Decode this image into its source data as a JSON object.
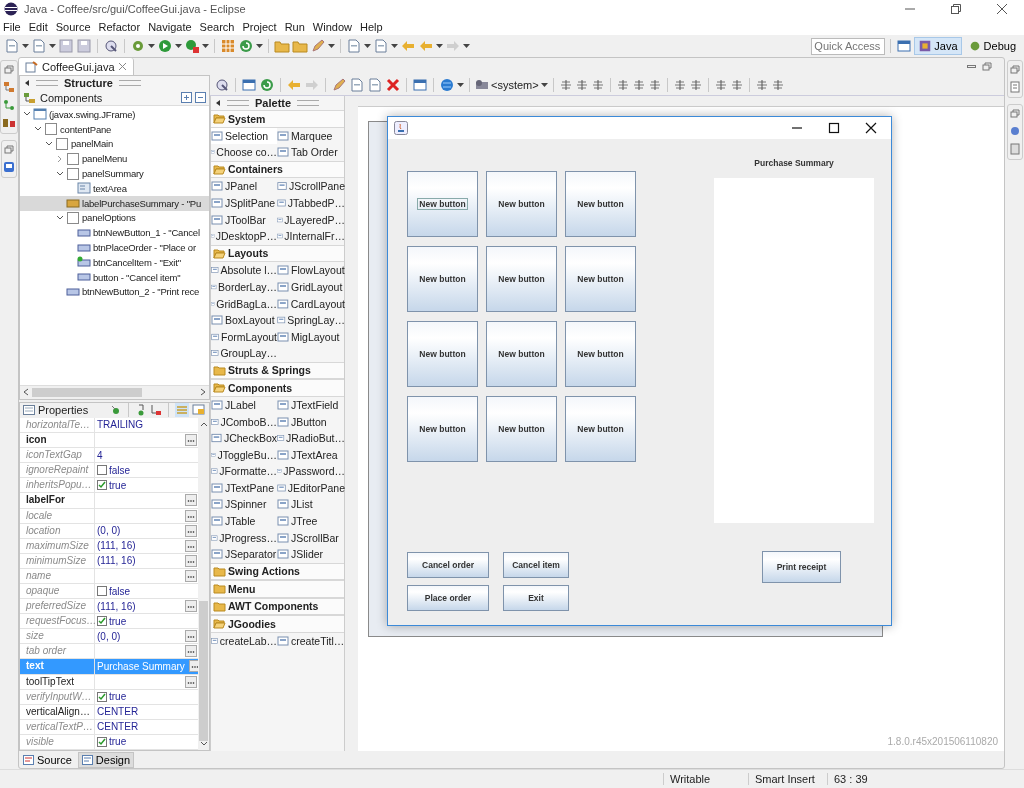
{
  "window": {
    "title": "Java - Coffee/src/gui/CoffeeGui.java - Eclipse"
  },
  "menu": [
    "File",
    "Edit",
    "Source",
    "Refactor",
    "Navigate",
    "Search",
    "Project",
    "Run",
    "Window",
    "Help"
  ],
  "toolbar": {
    "quick_access": {
      "placeholder": "Quick Access"
    },
    "perspectives": [
      {
        "label": "Java",
        "selected": true
      },
      {
        "label": "Debug",
        "selected": false
      }
    ]
  },
  "editor_tab": {
    "label": "CoffeeGui.java"
  },
  "structure": {
    "title": "Structure",
    "root_label": "Components",
    "tree": [
      {
        "label": "(javax.swing.JFrame)",
        "kind": "frame",
        "expanded": true,
        "selected": false,
        "children": [
          {
            "label": "contentPane",
            "kind": "panel",
            "expanded": true,
            "selected": false,
            "children": [
              {
                "label": "panelMain",
                "kind": "panel",
                "expanded": true,
                "selected": false,
                "children": [
                  {
                    "label": "panelMenu",
                    "kind": "panel",
                    "expanded": false,
                    "selected": false
                  },
                  {
                    "label": "panelSummary",
                    "kind": "panel",
                    "expanded": true,
                    "selected": false,
                    "children": [
                      {
                        "label": "textArea",
                        "kind": "textarea",
                        "selected": false
                      }
                    ]
                  },
                  {
                    "label": "labelPurchaseSummary - \"Pu",
                    "kind": "label",
                    "selected": true
                  },
                  {
                    "label": "panelOptions",
                    "kind": "panel",
                    "expanded": true,
                    "selected": false,
                    "children": [
                      {
                        "label": "btnNewButton_1 - \"Cancel",
                        "kind": "button",
                        "selected": false
                      },
                      {
                        "label": "btnPlaceOrder - \"Place or",
                        "kind": "button",
                        "selected": false
                      },
                      {
                        "label": "btnCancelItem - \"Exit\"",
                        "kind": "eventbutton",
                        "selected": false
                      },
                      {
                        "label": "button - \"Cancel item\"",
                        "kind": "button",
                        "selected": false
                      }
                    ]
                  },
                  {
                    "label": "btnNewButton_2 - \"Print rece",
                    "kind": "button",
                    "selected": false
                  }
                ]
              }
            ]
          }
        ]
      }
    ]
  },
  "properties": {
    "title": "Properties",
    "rows": [
      {
        "name": "horizontalTe…",
        "kind": "default",
        "value": "TRAILING",
        "selected": false,
        "ellipsis": false
      },
      {
        "name": "icon",
        "kind": "bold",
        "selected": false,
        "ellipsis": true
      },
      {
        "name": "iconTextGap",
        "kind": "default",
        "value": "4",
        "selected": false,
        "ellipsis": false
      },
      {
        "name": "ignoreRepaint",
        "kind": "default",
        "value": "false",
        "checked": false,
        "selected": false,
        "ellipsis": false
      },
      {
        "name": "inheritsPopu…",
        "kind": "default",
        "value": "true",
        "checked": true,
        "selected": false,
        "ellipsis": false
      },
      {
        "name": "labelFor",
        "kind": "bold",
        "selected": false,
        "ellipsis": true
      },
      {
        "name": "locale",
        "kind": "default",
        "selected": false,
        "ellipsis": true
      },
      {
        "name": "location",
        "kind": "default",
        "value": "(0, 0)",
        "selected": false,
        "ellipsis": true
      },
      {
        "name": "maximumSize",
        "kind": "default",
        "value": "(111, 16)",
        "selected": false,
        "ellipsis": true
      },
      {
        "name": "minimumSize",
        "kind": "default",
        "value": "(111, 16)",
        "selected": false,
        "ellipsis": true
      },
      {
        "name": "name",
        "kind": "default",
        "selected": false,
        "ellipsis": true
      },
      {
        "name": "opaque",
        "kind": "default",
        "value": "false",
        "checked": false,
        "selected": false,
        "ellipsis": false
      },
      {
        "name": "preferredSize",
        "kind": "default",
        "value": "(111, 16)",
        "selected": false,
        "ellipsis": true
      },
      {
        "name": "requestFocus…",
        "kind": "default",
        "value": "true",
        "checked": true,
        "selected": false,
        "ellipsis": false
      },
      {
        "name": "size",
        "kind": "default",
        "value": "(0, 0)",
        "selected": false,
        "ellipsis": true
      },
      {
        "name": "tab order",
        "kind": "default",
        "selected": false,
        "ellipsis": true
      },
      {
        "name": "text",
        "kind": "bold",
        "value": "Purchase Summary",
        "selected": true,
        "ellipsis": true
      },
      {
        "name": "toolTipText",
        "kind": "plain",
        "selected": false,
        "ellipsis": true
      },
      {
        "name": "verifyInputW…",
        "kind": "default",
        "value": "true",
        "checked": true,
        "selected": false,
        "ellipsis": false
      },
      {
        "name": "verticalAlign…",
        "kind": "plain",
        "value": "CENTER",
        "selected": false,
        "ellipsis": false
      },
      {
        "name": "verticalTextP…",
        "kind": "default",
        "value": "CENTER",
        "selected": false,
        "ellipsis": false
      },
      {
        "name": "visible",
        "kind": "default",
        "value": "true",
        "checked": true,
        "selected": false,
        "ellipsis": false
      }
    ]
  },
  "palette": {
    "title": "Palette",
    "groups": [
      {
        "name": "System",
        "expanded": true,
        "items": [
          {
            "label": "Selection",
            "selected": true
          },
          {
            "label": "Marquee",
            "selected": false
          },
          {
            "label": "Choose co…",
            "selected": false
          },
          {
            "label": "Tab Order",
            "selected": false
          }
        ]
      },
      {
        "name": "Containers",
        "expanded": true,
        "items": [
          {
            "label": "JPanel",
            "selected": false
          },
          {
            "label": "JScrollPane",
            "selected": false
          },
          {
            "label": "JSplitPane",
            "selected": false
          },
          {
            "label": "JTabbedP…",
            "selected": false
          },
          {
            "label": "JToolBar",
            "selected": false
          },
          {
            "label": "JLayeredP…",
            "selected": false
          },
          {
            "label": "JDesktopP…",
            "selected": false
          },
          {
            "label": "JInternalFr…",
            "selected": false
          }
        ]
      },
      {
        "name": "Layouts",
        "expanded": true,
        "items": [
          {
            "label": "Absolute l…",
            "selected": false
          },
          {
            "label": "FlowLayout",
            "selected": false
          },
          {
            "label": "BorderLay…",
            "selected": false
          },
          {
            "label": "GridLayout",
            "selected": false
          },
          {
            "label": "GridBagLa…",
            "selected": false
          },
          {
            "label": "CardLayout",
            "selected": false
          },
          {
            "label": "BoxLayout",
            "selected": false
          },
          {
            "label": "SpringLay…",
            "selected": false
          },
          {
            "label": "FormLayout",
            "selected": false
          },
          {
            "label": "MigLayout",
            "selected": false
          },
          {
            "label": "GroupLay…",
            "selected": false
          }
        ]
      },
      {
        "name": "Struts & Springs",
        "expanded": false
      },
      {
        "name": "Components",
        "expanded": true,
        "items": [
          {
            "label": "JLabel",
            "selected": false
          },
          {
            "label": "JTextField",
            "selected": false
          },
          {
            "label": "JComboB…",
            "selected": false
          },
          {
            "label": "JButton",
            "selected": false
          },
          {
            "label": "JCheckBox",
            "selected": false
          },
          {
            "label": "JRadioBut…",
            "selected": false
          },
          {
            "label": "JToggleBu…",
            "selected": false
          },
          {
            "label": "JTextArea",
            "selected": false
          },
          {
            "label": "JFormatte…",
            "selected": false
          },
          {
            "label": "JPassword…",
            "selected": false
          },
          {
            "label": "JTextPane",
            "selected": false
          },
          {
            "label": "JEditorPane",
            "selected": false
          },
          {
            "label": "JSpinner",
            "selected": false
          },
          {
            "label": "JList",
            "selected": false
          },
          {
            "label": "JTable",
            "selected": false
          },
          {
            "label": "JTree",
            "selected": false
          },
          {
            "label": "JProgress…",
            "selected": false
          },
          {
            "label": "JScrollBar",
            "selected": false
          },
          {
            "label": "JSeparator",
            "selected": false
          },
          {
            "label": "JSlider",
            "selected": false
          }
        ]
      },
      {
        "name": "Swing Actions",
        "expanded": false
      },
      {
        "name": "Menu",
        "expanded": false
      },
      {
        "name": "AWT Components",
        "expanded": false
      },
      {
        "name": "JGoodies",
        "expanded": true,
        "items": [
          {
            "label": "createLab…",
            "selected": false
          },
          {
            "label": "createTitl…",
            "selected": false
          }
        ]
      }
    ]
  },
  "design_toolbar": {
    "look_and_feel": "<system>"
  },
  "frame": {
    "grid_buttons": [
      {
        "label": "New button",
        "focused": true
      },
      {
        "label": "New button",
        "focused": false
      },
      {
        "label": "New button",
        "focused": false
      },
      {
        "label": "New button",
        "focused": false
      },
      {
        "label": "New button",
        "focused": false
      },
      {
        "label": "New button",
        "focused": false
      },
      {
        "label": "New button",
        "focused": false
      },
      {
        "label": "New button",
        "focused": false
      },
      {
        "label": "New button",
        "focused": false
      },
      {
        "label": "New button",
        "focused": false
      },
      {
        "label": "New button",
        "focused": false
      },
      {
        "label": "New button",
        "focused": false
      }
    ],
    "summary_label": "Purchase Summary",
    "option_buttons": [
      "Cancel order",
      "Cancel item",
      "Place order",
      "Exit"
    ],
    "print_button": "Print receipt"
  },
  "version": "1.8.0.r45x201506110820",
  "bottom_tabs": [
    {
      "label": "Source",
      "selected": false
    },
    {
      "label": "Design",
      "selected": true
    }
  ],
  "status_bar": [
    "Writable",
    "Smart Insert",
    "63 : 39"
  ]
}
